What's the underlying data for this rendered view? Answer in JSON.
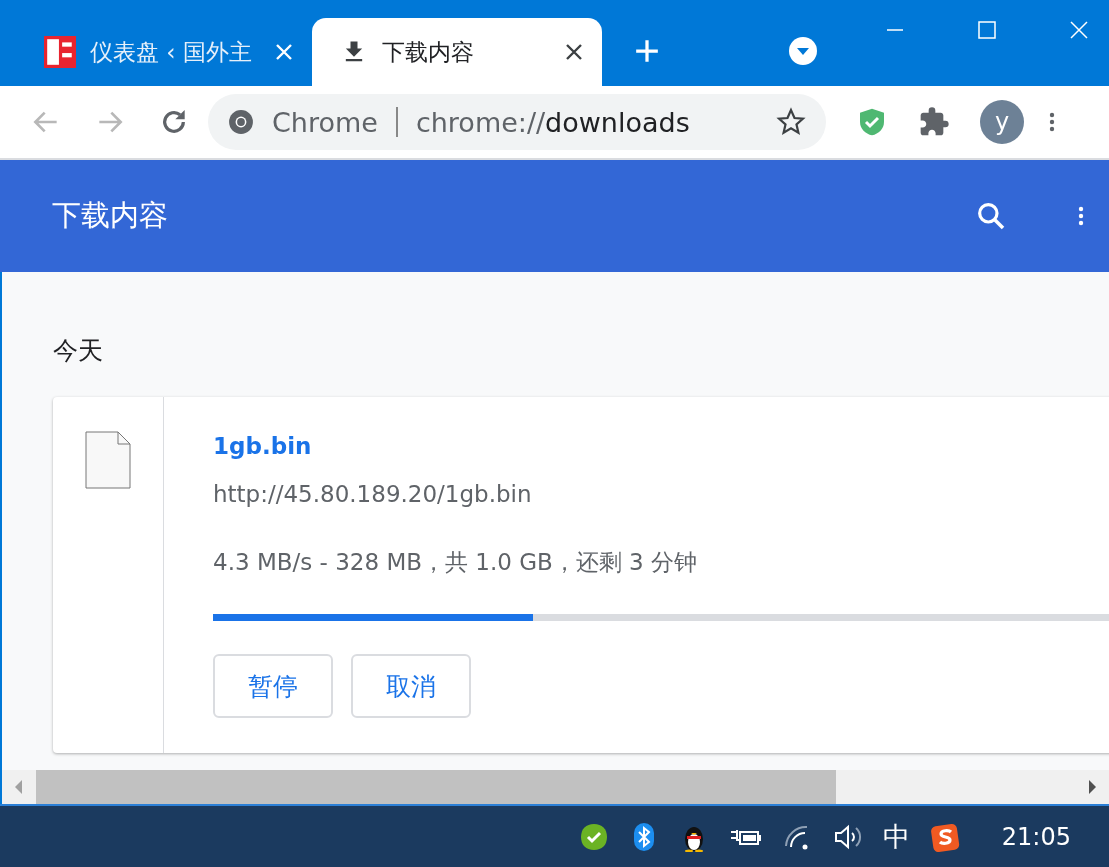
{
  "tabs": [
    {
      "title": "仪表盘 ‹ 国外主",
      "kind": "site",
      "selected": false
    },
    {
      "title": "下载内容",
      "kind": "download",
      "selected": true
    }
  ],
  "omnibox": {
    "site_label": "Chrome",
    "url_prefix": "chrome://",
    "url_path": "downloads"
  },
  "profile": {
    "initial": "y"
  },
  "header": {
    "title": "下载内容"
  },
  "section": {
    "date": "今天"
  },
  "downloads": [
    {
      "file_name": "1gb.bin",
      "url": "http://45.80.189.20/1gb.bin",
      "status": "4.3 MB/s - 328 MB，共 1.0 GB，还剩 3 分钟",
      "level": 0.32,
      "buttons": [
        "暂停",
        "取消"
      ]
    }
  ],
  "taskbar": {
    "ime": "中",
    "time": "21:05"
  }
}
